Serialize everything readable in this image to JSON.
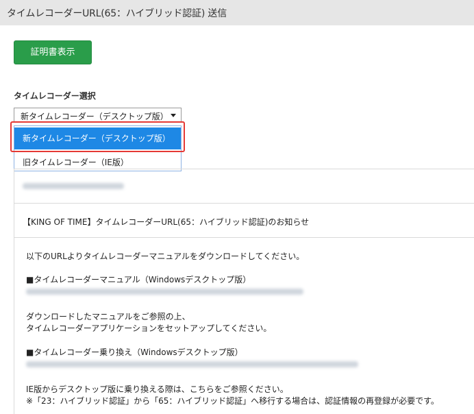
{
  "header": {
    "title": "タイムレコーダーURL(65：ハイブリッド認証) 送信"
  },
  "actions": {
    "certificate_button": "証明書表示"
  },
  "recorder_select": {
    "label": "タイムレコーダー選択",
    "selected": "新タイムレコーダー（デスクトップ版）",
    "options": [
      "新タイムレコーダー（デスクトップ版）",
      "旧タイムレコーダー（IE版）"
    ]
  },
  "mail": {
    "subject": "【KING OF TIME】タイムレコーダーURL(65：ハイブリッド認証)のお知らせ",
    "body": {
      "intro": "以下のURLよりタイムレコーダーマニュアルをダウンロードしてください。",
      "manual_heading": "■タイムレコーダーマニュアル（Windowsデスクトップ版）",
      "setup_line1": "ダウンロードしたマニュアルをご参照の上、",
      "setup_line2": "タイムレコーダーアプリケーションをセットアップしてください。",
      "switch_heading": "■タイムレコーダー乗り換え（Windowsデスクトップ版）",
      "ie_note": "IE版からデスクトップ版に乗り換える際は、こちらをご参照ください。",
      "migration_note": "※「23：ハイブリッド認証」から「65：ハイブリッド認証」へ移行する場合は、認証情報の再登録が必要です。"
    }
  },
  "colors": {
    "header_bg": "#e6e6e6",
    "button_green": "#2a9d4a",
    "selected_option": "#1e88e5",
    "highlight_red": "#e53935"
  }
}
